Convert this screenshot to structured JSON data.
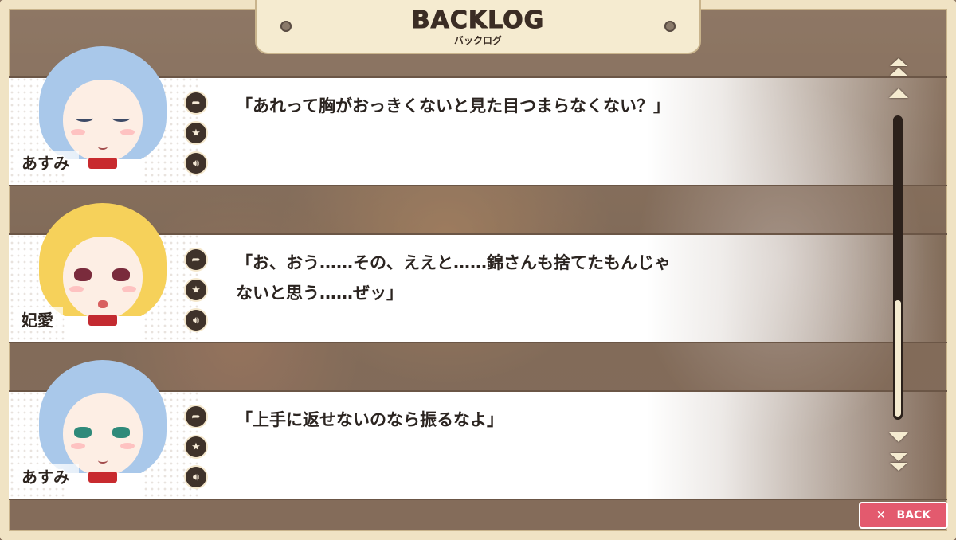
{
  "header": {
    "title": "BACKLOG",
    "subtitle": "バックログ"
  },
  "entries": [
    {
      "speaker": "あすみ",
      "text": "「あれって胸がおっきくないと見た目つまらなくない？」"
    },
    {
      "speaker": "妃愛",
      "text": "「お、おう……その、ええと……錦さんも捨てたもんじゃ\nないと思う……ぜッ」"
    },
    {
      "speaker": "あすみ",
      "text": "「上手に返せないのなら振るなよ」"
    }
  ],
  "entry_icons": [
    "jump-icon",
    "favorite-star-icon",
    "voice-replay-icon"
  ],
  "scrollbar": {
    "position_fraction": 1.0
  },
  "back_button": {
    "label": "BACK",
    "icon": "close-x-icon"
  },
  "colors": {
    "accent": "#e35a6e",
    "frame": "#f0e3c4",
    "dark": "#3f322a"
  }
}
